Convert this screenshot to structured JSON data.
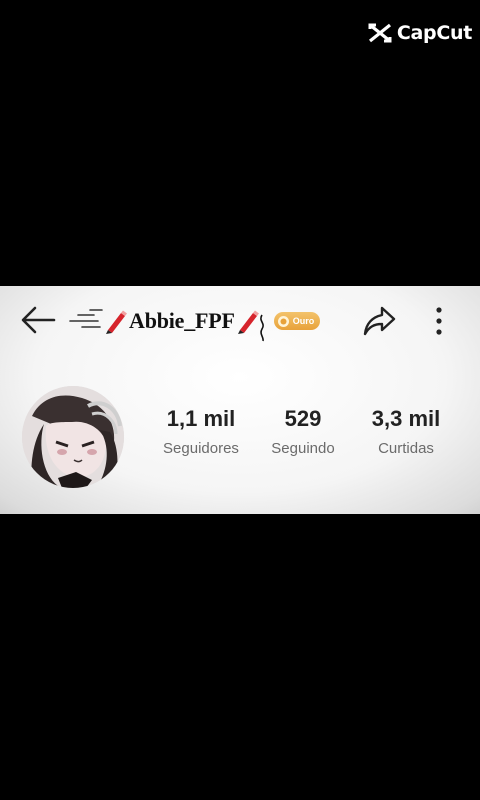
{
  "watermark": {
    "text": "CapCut",
    "icon": "capcut-logo-icon"
  },
  "header": {
    "username": "Abbie_FPF",
    "badge_label": "Ouro",
    "badge_color": "#e8a23a",
    "pencil_color": "#d6242c",
    "icons": [
      "back-arrow-icon",
      "speed-lines-icon",
      "pencil-icon",
      "share-icon",
      "more-vertical-icon"
    ]
  },
  "stats": [
    {
      "value": "1,1 mil",
      "label": "Seguidores"
    },
    {
      "value": "529",
      "label": "Seguindo"
    },
    {
      "value": "3,3 mil",
      "label": "Curtidas"
    }
  ],
  "colors": {
    "background": "#000000",
    "panel": "#f5f5f5",
    "text": "#222222",
    "muted": "#6b6b6b"
  }
}
